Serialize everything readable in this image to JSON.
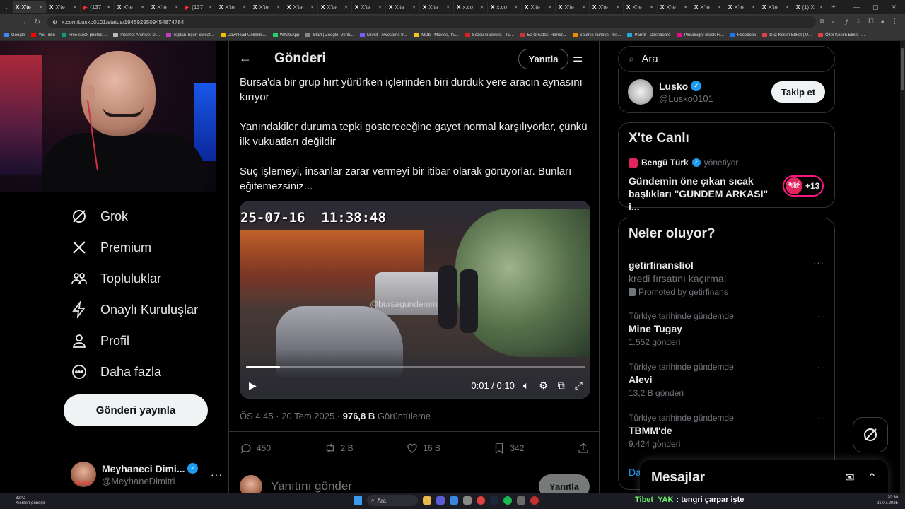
{
  "browser": {
    "tabs": [
      {
        "title": "X'te",
        "icon": "X",
        "active": true
      },
      {
        "title": "X'te",
        "icon": "X"
      },
      {
        "title": "(137",
        "icon": "▶",
        "yt": true
      },
      {
        "title": "X'te",
        "icon": "X"
      },
      {
        "title": "X'te",
        "icon": "X"
      },
      {
        "title": "(137",
        "icon": "▶",
        "yt": true
      },
      {
        "title": "X'te",
        "icon": "X"
      },
      {
        "title": "X'te",
        "icon": "X"
      },
      {
        "title": "X'te",
        "icon": "X"
      },
      {
        "title": "X'te",
        "icon": "X"
      },
      {
        "title": "X'te",
        "icon": "X"
      },
      {
        "title": "X'te",
        "icon": "X"
      },
      {
        "title": "X'te",
        "icon": "X"
      },
      {
        "title": "x.co",
        "icon": "X"
      },
      {
        "title": "x.co",
        "icon": "X"
      },
      {
        "title": "X'te",
        "icon": "X"
      },
      {
        "title": "X'te",
        "icon": "X"
      },
      {
        "title": "X'te",
        "icon": "X"
      },
      {
        "title": "X'te",
        "icon": "X"
      },
      {
        "title": "X'te",
        "icon": "X"
      },
      {
        "title": "X'te",
        "icon": "X"
      },
      {
        "title": "X'te",
        "icon": "X"
      },
      {
        "title": "X'te",
        "icon": "X"
      },
      {
        "title": "(1) X",
        "icon": "X"
      }
    ],
    "url": "x.com/Lusko0101/status/1946929509454874784",
    "bookmarks": [
      {
        "label": "Google",
        "color": "#4285f4"
      },
      {
        "label": "YouTube",
        "color": "#ff0000"
      },
      {
        "label": "Free stock photos ...",
        "color": "#05a081"
      },
      {
        "label": "Internet Archive: Di...",
        "color": "#bbbbbb"
      },
      {
        "label": "Toptan Tişört Sweat...",
        "color": "#c040c0"
      },
      {
        "label": "Download Unlimite...",
        "color": "#f0c000"
      },
      {
        "label": "WhatsApp",
        "color": "#25d366"
      },
      {
        "label": "Start | Zoogle: Verifi...",
        "color": "#888888"
      },
      {
        "label": "Mixkit - Awesome fr...",
        "color": "#7a5cff"
      },
      {
        "label": "IMDb - Movies, TV...",
        "color": "#f5c518"
      },
      {
        "label": "Sözcü Gazetesi - Tü...",
        "color": "#e02020"
      },
      {
        "label": "50 Greatest Horror...",
        "color": "#cc3333"
      },
      {
        "label": "Sputnik Türkiye - So...",
        "color": "#f08a00"
      },
      {
        "label": "Parrot - Dashboard",
        "color": "#22aadd"
      },
      {
        "label": "Pluralsight Black Fr...",
        "color": "#e80a89"
      },
      {
        "label": "Facebook",
        "color": "#1877f2"
      },
      {
        "label": "Düz Kesim Etiket | U...",
        "color": "#e04040"
      },
      {
        "label": "Özel Kesim Etiket -...",
        "color": "#e04040"
      }
    ]
  },
  "nav": {
    "items": [
      {
        "label": "Grok",
        "icon": "grok-icon"
      },
      {
        "label": "Premium",
        "icon": "x-logo-icon"
      },
      {
        "label": "Topluluklar",
        "icon": "communities-icon"
      },
      {
        "label": "Onaylı Kuruluşlar",
        "icon": "lightning-icon"
      },
      {
        "label": "Profil",
        "icon": "profile-icon"
      },
      {
        "label": "Daha fazla",
        "icon": "more-circle-icon"
      }
    ],
    "post_button": "Gönderi yayınla",
    "user": {
      "name": "Meyhaneci Dimi...",
      "handle": "@MeyhaneDimitri",
      "avatar_label": "DİMİTR"
    }
  },
  "post": {
    "header_title": "Gönderi",
    "reply_top": "Yanıtla",
    "paragraphs": [
      "Bursa'da bir grup hırt yürürken içlerinden biri durduk yere aracın aynasını kırıyor",
      "Yanındakiler duruma tepki göstereceğine gayet normal karşılıyorlar, çünkü ilk vukuatları değildir",
      "Suç işlemeyi, insanlar zarar vermeyi bir itibar olarak görüyorlar. Bunları eğitemezsiniz..."
    ],
    "video": {
      "timestamp": "25-07-16  11:38:48",
      "watermark": "@bursagundemm",
      "time": "0:01 / 0:10",
      "progress": 0.1
    },
    "meta": {
      "time": "ÖS 4:45 · 20 Tem 2025 · ",
      "views": "976,8 B",
      "views_label": " Görüntüleme"
    },
    "stats": {
      "replies": "450",
      "reposts": "2 B",
      "likes": "16 B",
      "bookmarks": "342"
    },
    "reply_placeholder": "Yanıtını gönder",
    "reply_button": "Yanıtla"
  },
  "sidebar": {
    "search_value": "Ara",
    "follow": {
      "name": "Lusko",
      "handle": "@Lusko0101",
      "button": "Takip et"
    },
    "live": {
      "title": "X'te Canlı",
      "host": "Bengü Türk",
      "role": "yönetiyor",
      "text": "Gündemin öne çıkan sıcak başlıkları \"GÜNDEM ARKASI\" i...",
      "count": "+13",
      "mini_label": "BENGÜ TÜRK"
    },
    "happening": {
      "title": "Neler oluyor?",
      "promo": {
        "name": "getirfinansliol",
        "sub": "kredi fırsatını kaçırma!",
        "promoted": "Promoted by getirfinans"
      },
      "trends": [
        {
          "context": "Türkiye tarihinde gündemde",
          "name": "Mine Tugay",
          "count": "1.552 gönderi"
        },
        {
          "context": "Türkiye tarihinde gündemde",
          "name": "Alevi",
          "count": "13,2 B gönderi"
        },
        {
          "context": "Türkiye tarihinde gündemde",
          "name": "TBMM'de",
          "count": "9.424 gönderi"
        }
      ],
      "show_more": "Da"
    },
    "messages": "Mesajlar"
  },
  "taskbar": {
    "weather_temp": "32°C",
    "weather_desc": "Kısmen güneşli",
    "search": "Ara",
    "ticker_name": "Tibet_YAK",
    "ticker_text": ": tengri çarpar işte",
    "time": "20:30",
    "date": "21.07.2025"
  }
}
